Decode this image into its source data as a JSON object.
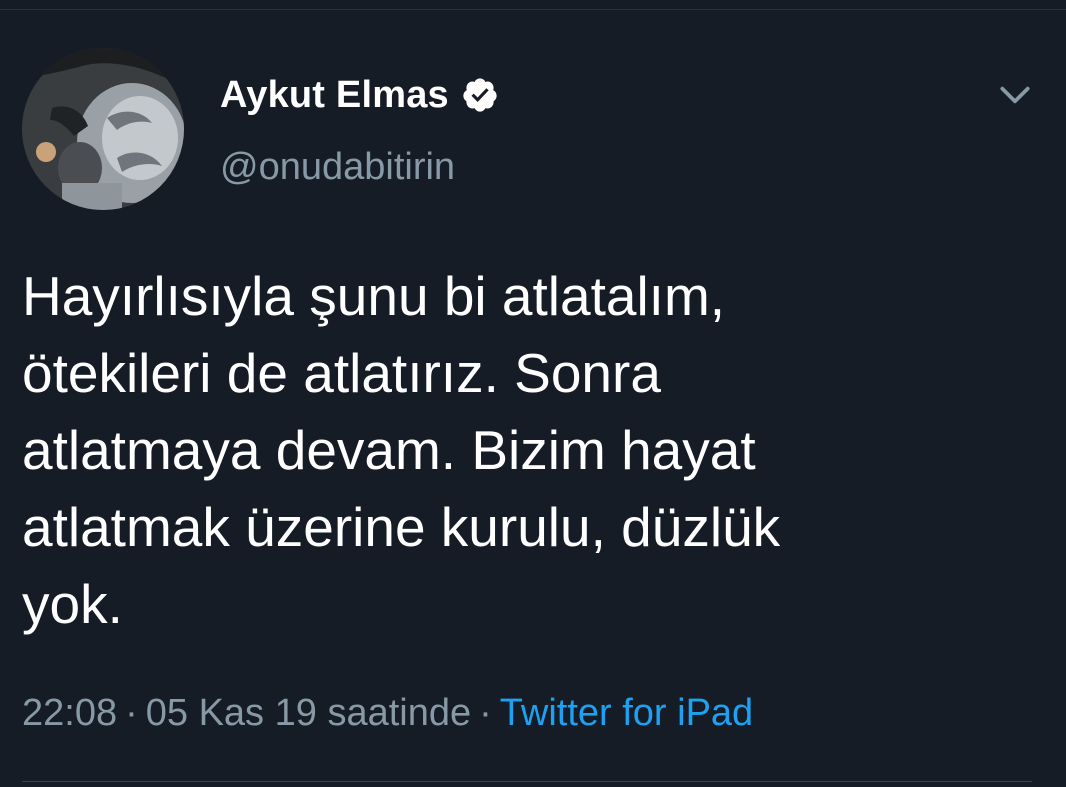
{
  "author": {
    "display_name": "Aykut Elmas",
    "handle": "@onudabitirin",
    "verified": true
  },
  "tweet": {
    "lines": [
      "Hayırlısıyla şunu bi atlatalım,",
      "ötekileri de atlatırız. Sonra",
      "atlatmaya devam. Bizim hayat",
      "atlatmak üzerine kurulu, düzlük",
      "yok."
    ],
    "time": "22:08",
    "date_text": "05 Kas 19 saatinde",
    "separator": "·",
    "source": "Twitter for iPad"
  },
  "icons": {
    "verified": "verified-badge-icon",
    "menu": "chevron-down-icon"
  },
  "colors": {
    "background": "#151c26",
    "text": "#ffffff",
    "secondary": "#8899a6",
    "link": "#1da1f2"
  }
}
